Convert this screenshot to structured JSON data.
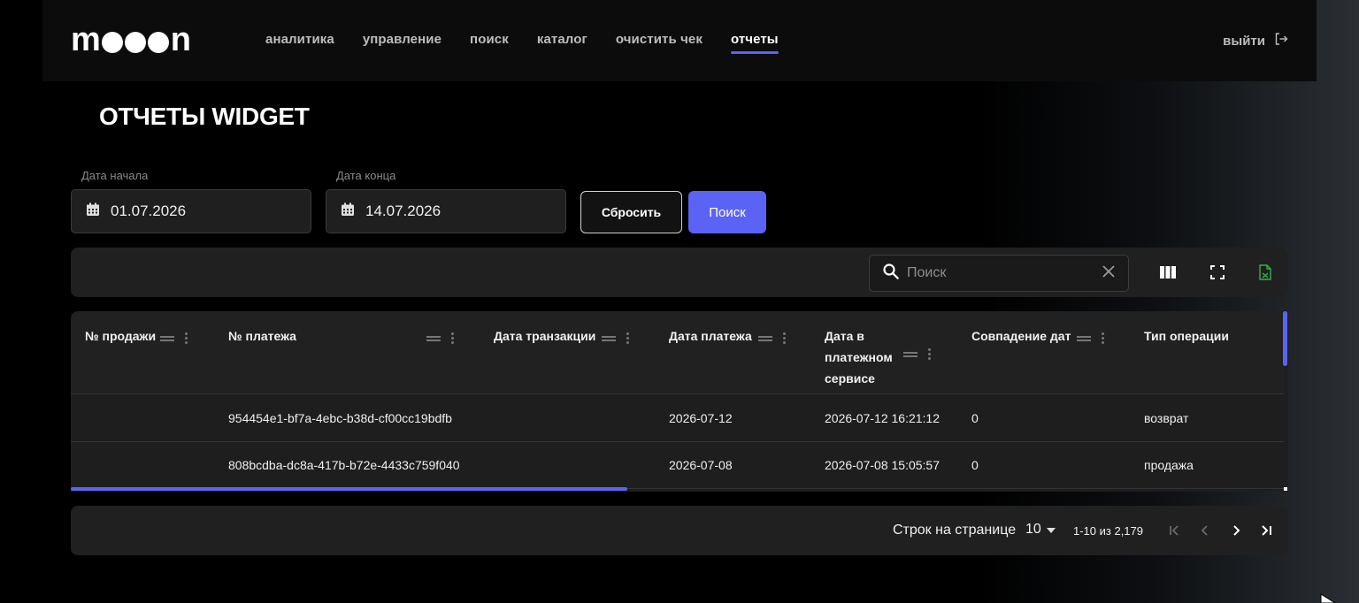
{
  "header": {
    "logo_parts": [
      "m",
      "n"
    ],
    "logo_text": "mooon",
    "nav": [
      {
        "label": "аналитика",
        "active": false
      },
      {
        "label": "управление",
        "active": false
      },
      {
        "label": "поиск",
        "active": false
      },
      {
        "label": "каталог",
        "active": false
      },
      {
        "label": "очистить чек",
        "active": false
      },
      {
        "label": "отчеты",
        "active": true
      }
    ],
    "logout_label": "выйти",
    "logout_icon": "logout-icon"
  },
  "page": {
    "title": "ОТЧЕТЫ WIDGET"
  },
  "filters": {
    "start_label": "Дата начала",
    "start_value": "01.07.2026",
    "end_label": "Дата конца",
    "end_value": "14.07.2026",
    "calendar_icon": "calendar-icon",
    "reset_label": "Сбросить",
    "search_label": "Поиск"
  },
  "toolbar": {
    "search_placeholder": "Поиск",
    "search_icon": "search-icon",
    "clear_icon": "close-icon",
    "columns_icon": "columns-icon",
    "fullscreen_icon": "fullscreen-icon",
    "export_icon": "export-file-icon"
  },
  "table": {
    "columns": [
      "№ продажи",
      "№ платежа",
      "Дата транзакции",
      "Дата платежа",
      "Дата в платежном сервисе",
      "Совпадение дат",
      "Тип операции"
    ],
    "column_lines": {
      "payment_service": [
        "Дата в",
        "платежном",
        "сервисе"
      ]
    },
    "rows": [
      {
        "sale_no": "",
        "payment_no": "954454e1-bf7a-4ebc-b38d-cf00cc19bdfb",
        "transaction_date": "",
        "payment_date": "2026-07-12",
        "service_date": "2026-07-12 16:21:12",
        "dates_match": "0",
        "operation_type": "возврат"
      },
      {
        "sale_no": "",
        "payment_no": "808bcdba-dc8a-417b-b72e-4433c759f040",
        "transaction_date": "",
        "payment_date": "2026-07-08",
        "service_date": "2026-07-08 15:05:57",
        "dates_match": "0",
        "operation_type": "продажа"
      }
    ]
  },
  "pagination": {
    "rows_per_page_label": "Строк на странице",
    "rows_per_page_value": "10",
    "range_label": "1-10 из 2,179",
    "first_icon": "first-page-icon",
    "prev_icon": "chevron-left-icon",
    "next_icon": "chevron-right-icon",
    "last_icon": "last-page-icon"
  },
  "colors": {
    "accent": "#5b63f5",
    "background": "#000000",
    "panel": "#202020"
  }
}
